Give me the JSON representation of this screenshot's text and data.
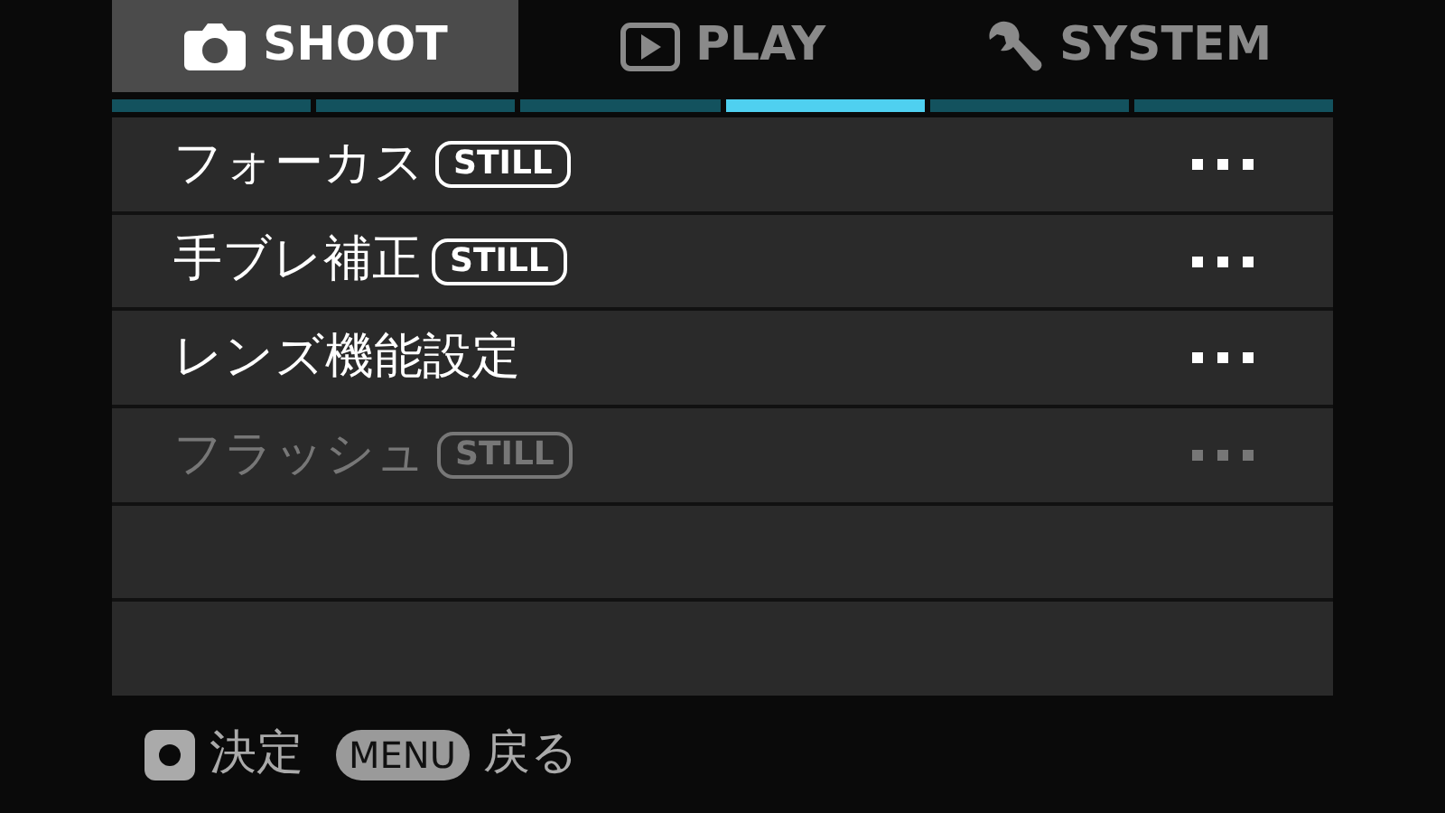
{
  "tabs": [
    {
      "label": "SHOOT",
      "kind": "camera",
      "selected": true
    },
    {
      "label": "PLAY",
      "kind": "play",
      "selected": false
    },
    {
      "label": "SYSTEM",
      "kind": "wrench",
      "selected": false
    }
  ],
  "page_indicator": [
    {
      "selected": false
    },
    {
      "selected": false
    },
    {
      "selected": false
    },
    {
      "selected": true
    },
    {
      "selected": false
    },
    {
      "selected": false
    }
  ],
  "menu_items": [
    {
      "label": "フォーカス",
      "badge": "STILL",
      "disabled": false
    },
    {
      "label": "手ブレ補正",
      "badge": "STILL",
      "disabled": false
    },
    {
      "label": "レンズ機能設定",
      "disabled": false
    },
    {
      "label": "フラッシュ",
      "badge": "STILL",
      "disabled": true
    }
  ],
  "footer": {
    "confirm_label": "決定",
    "menu_key": "MENU",
    "back_label": "戻る"
  }
}
